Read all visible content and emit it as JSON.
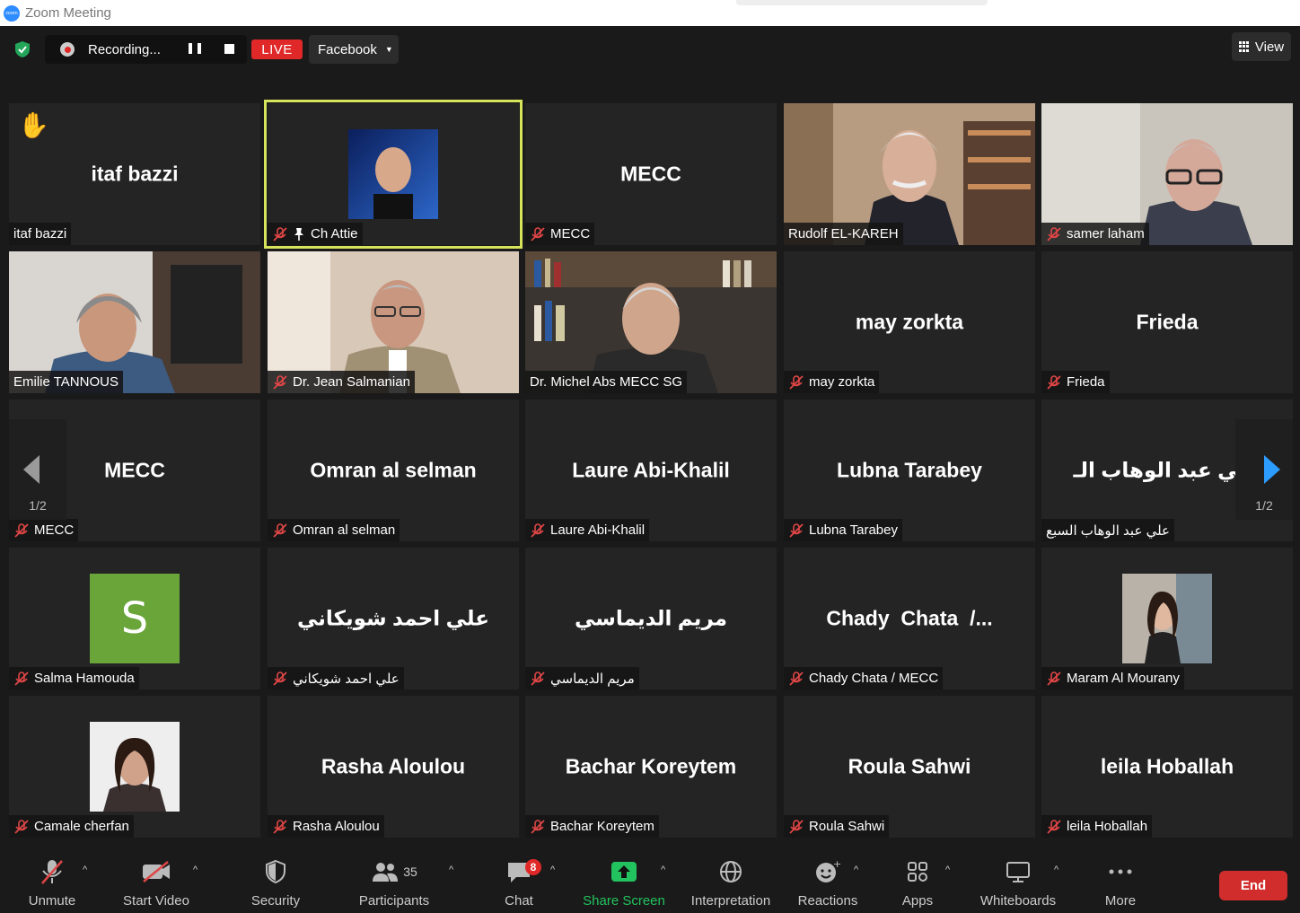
{
  "window": {
    "title": "Zoom Meeting"
  },
  "topbar": {
    "recording_label": "Recording...",
    "live_label": "LIVE",
    "stream_target": "Facebook",
    "view_label": "View"
  },
  "pagination": {
    "left_label": "1/2",
    "right_label": "1/2"
  },
  "tiles": [
    {
      "center": "itaf bazzi",
      "name": "itaf bazzi",
      "muted": false
    },
    {
      "center": "",
      "name": "Ch Attie",
      "muted": true
    },
    {
      "center": "MECC",
      "name": "MECC",
      "muted": true
    },
    {
      "center": "",
      "name": "Rudolf EL-KAREH",
      "muted": false
    },
    {
      "center": "",
      "name": "samer laham",
      "muted": true
    },
    {
      "center": "",
      "name": "Emilie TANNOUS",
      "muted": false
    },
    {
      "center": "",
      "name": "Dr. Jean Salmanian",
      "muted": true
    },
    {
      "center": "",
      "name": "Dr. Michel Abs MECC SG",
      "muted": false
    },
    {
      "center": "may zorkta",
      "name": "may zorkta",
      "muted": true
    },
    {
      "center": "Frieda",
      "name": "Frieda",
      "muted": true
    },
    {
      "center": "MECC",
      "name": "MECC",
      "muted": true
    },
    {
      "center": "Omran al selman",
      "name": "Omran al selman",
      "muted": true
    },
    {
      "center": "Laure Abi-Khalil",
      "name": "Laure Abi-Khalil",
      "muted": true
    },
    {
      "center": "Lubna Tarabey",
      "name": "Lubna Tarabey",
      "muted": true
    },
    {
      "center": "علي عبد الوهاب الـ",
      "name": "علي عبد الوهاب السبع",
      "muted": false
    },
    {
      "center": "S",
      "name": "Salma Hamouda",
      "muted": true
    },
    {
      "center": "علي احمد شويكاني",
      "name": "علي احمد شويكاني",
      "muted": true
    },
    {
      "center": "مريم الديماسي",
      "name": "مريم الديماسي",
      "muted": true
    },
    {
      "center": "Chady  Chata  /...",
      "name": "Chady Chata / MECC",
      "muted": true
    },
    {
      "center": "",
      "name": "Maram Al Mourany",
      "muted": true
    },
    {
      "center": "",
      "name": "Camale cherfan",
      "muted": true
    },
    {
      "center": "Rasha Aloulou",
      "name": "Rasha Aloulou",
      "muted": true
    },
    {
      "center": "Bachar Koreytem",
      "name": "Bachar Koreytem",
      "muted": true
    },
    {
      "center": "Roula Sahwi",
      "name": "Roula Sahwi",
      "muted": true
    },
    {
      "center": "leila Hoballah",
      "name": "leila Hoballah",
      "muted": true
    }
  ],
  "toolbar": {
    "unmute": "Unmute",
    "start_video": "Start Video",
    "security": "Security",
    "participants": "Participants",
    "participants_count": "35",
    "chat": "Chat",
    "chat_badge": "8",
    "share_screen": "Share Screen",
    "interpretation": "Interpretation",
    "reactions": "Reactions",
    "apps": "Apps",
    "whiteboards": "Whiteboards",
    "more": "More",
    "end": "End"
  },
  "colors": {
    "active_speaker": "#d6e45c",
    "live": "#e02828",
    "share_green": "#22c35e",
    "end_red": "#d12d2d",
    "mute_red": "#e04646"
  }
}
